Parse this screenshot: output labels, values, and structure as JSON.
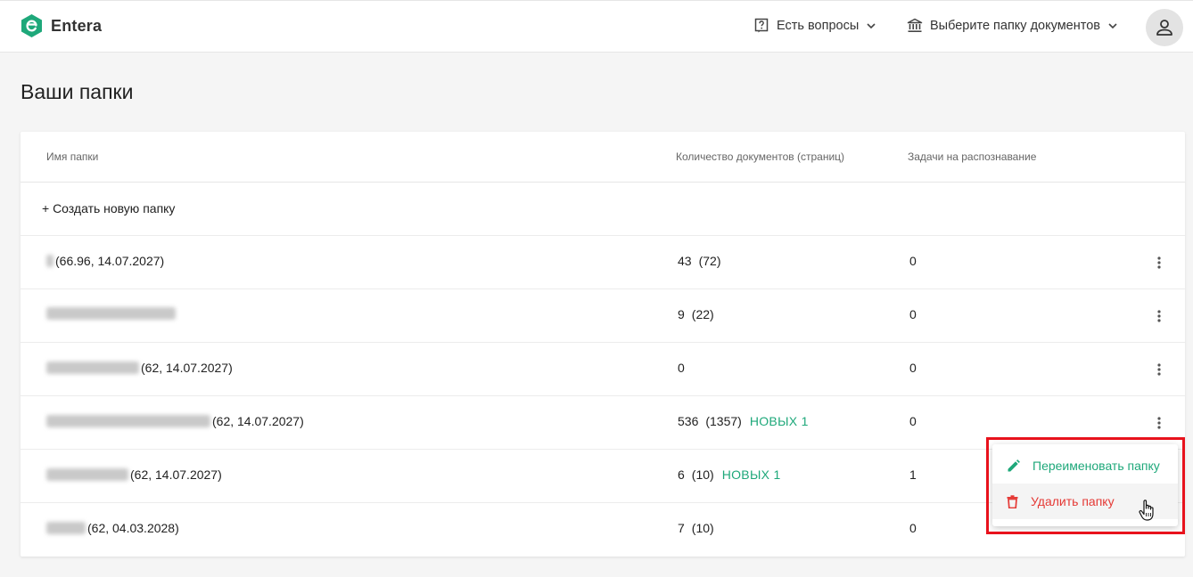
{
  "app": {
    "name": "Entera"
  },
  "header": {
    "help_label": "Есть вопросы",
    "folder_select_label": "Выберите папку документов"
  },
  "page": {
    "title": "Ваши папки"
  },
  "table": {
    "columns": [
      "Имя папки",
      "Количество документов (страниц)",
      "Задачи на распознавание"
    ],
    "create_label": "+ Создать новую папку",
    "rows": [
      {
        "name_visible": "(66.96, 14.07.2027)",
        "docs": "43",
        "pages": "(72)",
        "badge": "",
        "tasks": "0"
      },
      {
        "name_visible": "",
        "docs": "9",
        "pages": "(22)",
        "badge": "",
        "tasks": "0"
      },
      {
        "name_visible": "(62, 14.07.2027)",
        "docs": "0",
        "pages": "",
        "badge": "",
        "tasks": "0"
      },
      {
        "name_visible": "(62, 14.07.2027)",
        "docs": "536",
        "pages": "(1357)",
        "badge": "НОВЫХ 1",
        "tasks": "0"
      },
      {
        "name_visible": "(62, 14.07.2027)",
        "docs": "6",
        "pages": "(10)",
        "badge": "НОВЫХ 1",
        "tasks": "1"
      },
      {
        "name_visible": "(62, 04.03.2028)",
        "docs": "7",
        "pages": "(10)",
        "badge": "",
        "tasks": "0"
      }
    ]
  },
  "context_menu": {
    "rename_label": "Переименовать папку",
    "delete_label": "Удалить папку"
  },
  "colors": {
    "accent": "#1ea87a",
    "danger": "#e53935",
    "highlight": "#e8121c"
  },
  "icons": [
    "entera-logo-icon",
    "help-icon",
    "chevron-down-icon",
    "bank-icon",
    "user-icon",
    "more-vert-icon",
    "pencil-icon",
    "trash-icon",
    "hand-cursor-icon"
  ]
}
